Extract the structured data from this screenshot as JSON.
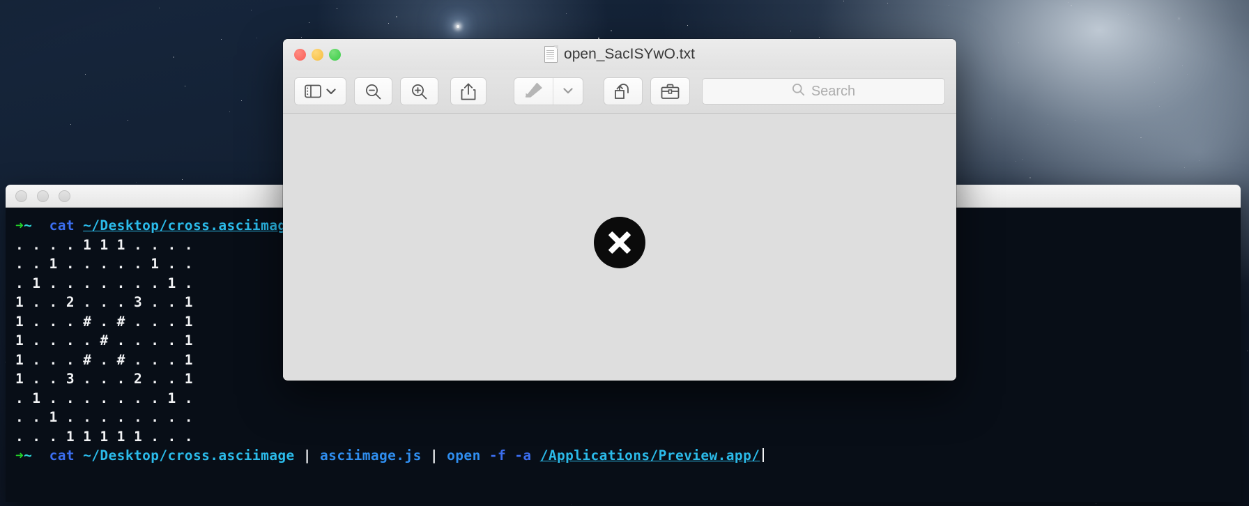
{
  "desktop": {
    "wallpaper_name": "starfield-galaxy-wallpaper"
  },
  "preview_window": {
    "title": "open_SacISYwO.txt",
    "doc_icon": "document-icon",
    "traffic_lights": [
      {
        "name": "close",
        "color": "#fa5e57"
      },
      {
        "name": "minimize",
        "color": "#f5bd3f"
      },
      {
        "name": "zoom",
        "color": "#38cc46"
      }
    ],
    "toolbar": {
      "sidebar_button": "sidebar-icon",
      "sidebar_chevron": "chevron-down-icon",
      "zoom_out_button": "zoom-out-icon",
      "zoom_in_button": "zoom-in-icon",
      "share_button": "share-icon",
      "markup_button": "markup-pen-icon",
      "markup_chevron": "chevron-down-icon",
      "rotate_button": "rotate-left-icon",
      "toolkit_button": "briefcase-icon",
      "search": {
        "placeholder": "Search",
        "value": "",
        "icon": "search-icon"
      }
    },
    "content": {
      "state_icon": "failed-to-open-x-icon",
      "state_label": ""
    }
  },
  "terminal_window": {
    "traffic_lights": [
      {
        "name": "close",
        "color": "#d8d8d8"
      },
      {
        "name": "minimize",
        "color": "#d8d8d8"
      },
      {
        "name": "zoom",
        "color": "#d8d8d8"
      }
    ],
    "prompt": {
      "arrow": "➜",
      "host": "~"
    },
    "command_1": {
      "program": "cat",
      "path": "~/Desktop/cross.asciimage"
    },
    "ascii_art": [
      ". . . . 1 1 1 . . . .",
      ". . 1 . . . . . 1 . .",
      ". 1 . . . . . . . 1 .",
      "1 . . 2 . . . 3 . . 1",
      "1 . . . # . # . . . 1",
      "1 . . . . # . . . . 1",
      "1 . . . # . # . . . 1",
      "1 . . 3 . . . 2 . . 1",
      ". 1 . . . . . . . 1 .",
      ". . 1 . . . . . . . .",
      ". . . 1 1 1 1 1 . . ."
    ],
    "command_2": {
      "program": "cat",
      "path": "~/Desktop/cross.asciimage",
      "pipe1": "|",
      "filter": "asciimage.js",
      "pipe2": "|",
      "open_cmd": "open",
      "flags": "-f -a",
      "app_path": "/Applications/Preview.app/"
    }
  },
  "colors": {
    "terminal_bg": "#080e17",
    "terminal_text": "#f3f4f6",
    "prompt_green": "#22d327",
    "prompt_cyan": "#2fd8d8",
    "cmd_blue": "#3b6ef0",
    "path_cyan": "#2bbbea",
    "preview_bg": "#dedede",
    "toolbar_bg": "#e4e4e4"
  }
}
